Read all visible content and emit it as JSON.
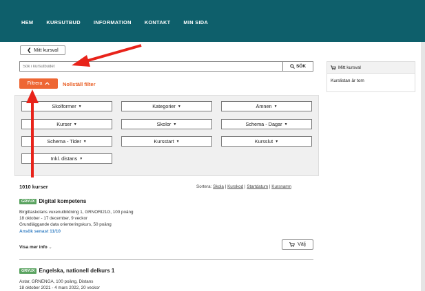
{
  "nav": [
    "HEM",
    "KURSUTBUD",
    "INFORMATION",
    "KONTAKT",
    "MIN SIDA"
  ],
  "back_label": "Mitt kursval",
  "search": {
    "placeholder": "Sök i kursutbudet",
    "button": "SÖK"
  },
  "filter_button": "Filtrera",
  "reset_filter": "Nollställ filter",
  "filters": {
    "skolformer": "Skolformer",
    "kategorier": "Kategorier",
    "amnen": "Ämnen",
    "kurser": "Kurser",
    "skolor": "Skolor",
    "schema_dagar": "Schema - Dagar",
    "schema_tider": "Schema - Tider",
    "kursstart": "Kursstart",
    "kursslut": "Kursslut",
    "distans": "Inkl. distans"
  },
  "results_count": "1010 kurser",
  "sort": {
    "label": "Sortera:",
    "skola": "Skola",
    "kurskod": "Kurskod",
    "startdatum": "Startdatum",
    "kursnamn": "Kursnamn"
  },
  "courses": [
    {
      "badge": "GRVUX",
      "title": "Digital kompetens",
      "line1": "Birgittaskolans vuxenutbildning 1, GRNORI21G, 100 poäng",
      "line2": "18 oktober - 17 december, 9 veckor",
      "line3": "Grundläggande data orienteringskurs, 50 poäng",
      "apply": "Ansök senast 11/10",
      "more": "Visa mer info",
      "choose": "Välj"
    },
    {
      "badge": "GRVUX",
      "title": "Engelska, nationell delkurs 1",
      "line1": "Astar, GRNENGA, 100 poäng, Distans",
      "line2": "18 oktober 2021 - 4 mars 2022, 20 veckor"
    }
  ],
  "sidebar": {
    "title": "Mitt kursval",
    "empty": "Kurslistan är tom"
  },
  "colors": {
    "header": "#0e5f6b",
    "accent": "#ee6633",
    "arrow": "#e8231a",
    "badge": "#5aa360",
    "link": "#3a82c4"
  }
}
